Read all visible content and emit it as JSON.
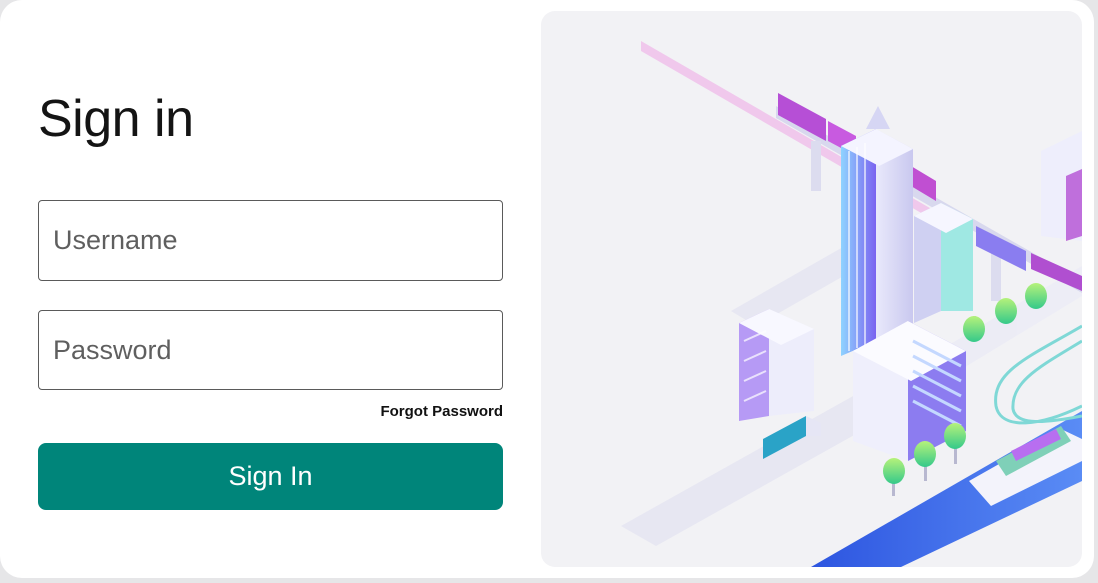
{
  "form": {
    "title": "Sign in",
    "username_placeholder": "Username",
    "password_placeholder": "Password",
    "forgot_password_label": "Forgot Password",
    "submit_label": "Sign In"
  },
  "colors": {
    "primary_button": "#00857a",
    "illustration_background": "#f2f2f5"
  },
  "illustration": {
    "name": "isometric-city-illustration"
  }
}
